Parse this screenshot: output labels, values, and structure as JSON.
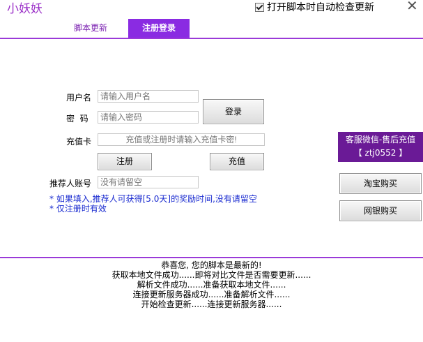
{
  "window": {
    "title": "小妖妖",
    "auto_check_label": "打开脚本时自动检查更新",
    "auto_check_checked": true,
    "close_icon": "close-icon"
  },
  "tabs": [
    {
      "label": "脚本更新",
      "active": false
    },
    {
      "label": "注册登录",
      "active": true
    }
  ],
  "form": {
    "username_label": "用户名",
    "username_placeholder": "请输入用户名",
    "password_label": "密  码",
    "password_placeholder": "请输入密码",
    "login_button": "登录",
    "recharge_label": "充值卡",
    "recharge_placeholder": "充值或注册时请输入充值卡密!",
    "register_button": "注册",
    "recharge_button": "充值",
    "referrer_label": "推荐人账号",
    "referrer_placeholder": "没有请留空",
    "hint_1": "* 如果填入,推荐人可获得[5.0天]的奖励时间,没有请留空",
    "hint_2": "* 仅注册时有效"
  },
  "side": {
    "service_line1": "客服微信-售后充值",
    "service_line2": "【 ztj0552 】",
    "taobao_button": "淘宝购买",
    "bank_button": "网银购买"
  },
  "log": [
    "恭喜您, 您的脚本是最新的!",
    "获取本地文件成功......即将对比文件是否需要更新......",
    "解析文件成功......准备获取本地文件......",
    "连接更新服务器成功......准备解析文件......",
    "开始检查更新......连接更新服务器......"
  ],
  "colors": {
    "accent": "#8a2be2",
    "title": "#9b30c8",
    "hint": "#1a2bd0",
    "service_bg": "#6a1a96"
  }
}
